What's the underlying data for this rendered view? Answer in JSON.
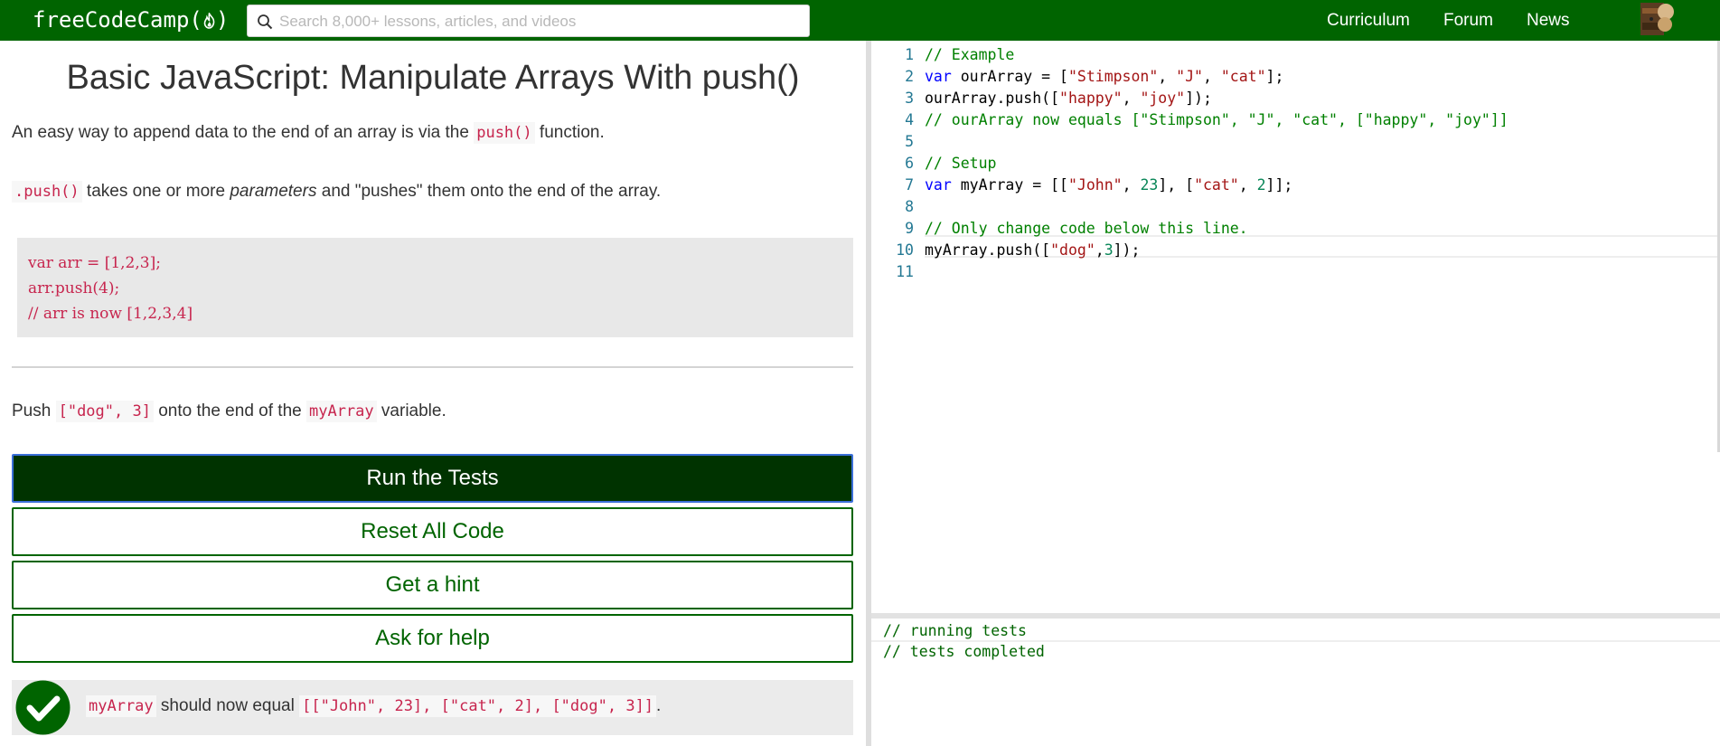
{
  "nav": {
    "logo": "freeCodeCamp(",
    "logo_end": ")",
    "search_placeholder": "Search 8,000+ lessons, articles, and videos",
    "links": [
      "Curriculum",
      "Forum",
      "News"
    ]
  },
  "challenge": {
    "title": "Basic JavaScript: Manipulate Arrays With push()",
    "p1_a": "An easy way to append data to the end of an array is via the ",
    "p1_code": "push()",
    "p1_b": " function.",
    "p2_code": ".push()",
    "p2_a": " takes one or more ",
    "p2_em": "parameters",
    "p2_b": " and \"pushes\" them onto the end of the array.",
    "example_lines": [
      "var arr = [1,2,3];",
      "arr.push(4);",
      "// arr is now [1,2,3,4]"
    ],
    "task_a": "Push ",
    "task_code1": "[\"dog\", 3]",
    "task_b": " onto the end of the ",
    "task_code2": "myArray",
    "task_c": " variable."
  },
  "buttons": {
    "run": "Run the Tests",
    "reset": "Reset All Code",
    "hint": "Get a hint",
    "help": "Ask for help"
  },
  "test_result": {
    "code1": "myArray",
    "text": " should now equal ",
    "code2": "[[\"John\", 23], [\"cat\", 2], [\"dog\", 3]]",
    "end": "."
  },
  "editor": {
    "lines": [
      {
        "n": "1",
        "parts": [
          [
            "cm",
            "// Example"
          ]
        ]
      },
      {
        "n": "2",
        "parts": [
          [
            "kw",
            "var"
          ],
          [
            "",
            " ourArray = ["
          ],
          [
            "st",
            "\"Stimpson\""
          ],
          [
            "",
            ", "
          ],
          [
            "st",
            "\"J\""
          ],
          [
            "",
            ", "
          ],
          [
            "st",
            "\"cat\""
          ],
          [
            "",
            "];"
          ]
        ]
      },
      {
        "n": "3",
        "parts": [
          [
            "",
            "ourArray.push(["
          ],
          [
            "st",
            "\"happy\""
          ],
          [
            "",
            ", "
          ],
          [
            "st",
            "\"joy\""
          ],
          [
            "",
            "]);"
          ]
        ]
      },
      {
        "n": "4",
        "parts": [
          [
            "cm",
            "// ourArray now equals [\"Stimpson\", \"J\", \"cat\", [\"happy\", \"joy\"]]"
          ]
        ]
      },
      {
        "n": "5",
        "parts": []
      },
      {
        "n": "6",
        "parts": [
          [
            "cm",
            "// Setup"
          ]
        ]
      },
      {
        "n": "7",
        "parts": [
          [
            "kw",
            "var"
          ],
          [
            "",
            " myArray = [["
          ],
          [
            "st",
            "\"John\""
          ],
          [
            "",
            ", "
          ],
          [
            "nm",
            "23"
          ],
          [
            "",
            "], ["
          ],
          [
            "st",
            "\"cat\""
          ],
          [
            "",
            ", "
          ],
          [
            "nm",
            "2"
          ],
          [
            "",
            "]];"
          ]
        ]
      },
      {
        "n": "8",
        "parts": []
      },
      {
        "n": "9",
        "parts": [
          [
            "cm",
            "// Only change code below this line."
          ]
        ]
      },
      {
        "n": "10",
        "parts": [
          [
            "",
            "myArray.push(["
          ],
          [
            "st",
            "\"dog\""
          ],
          [
            "",
            ","
          ],
          [
            "nm",
            "3"
          ],
          [
            "",
            "]);"
          ]
        ]
      },
      {
        "n": "11",
        "parts": []
      }
    ]
  },
  "output": {
    "lines": [
      "// running tests",
      "// tests completed"
    ]
  },
  "colors": {
    "brand": "#006400",
    "run_button": "#003300",
    "code_text": "#c7254e",
    "test_pass": "#006400"
  },
  "icons": {
    "logo": "fire-icon",
    "search": "search-icon",
    "result": "check-circle-icon",
    "avatar": "user-avatar"
  }
}
